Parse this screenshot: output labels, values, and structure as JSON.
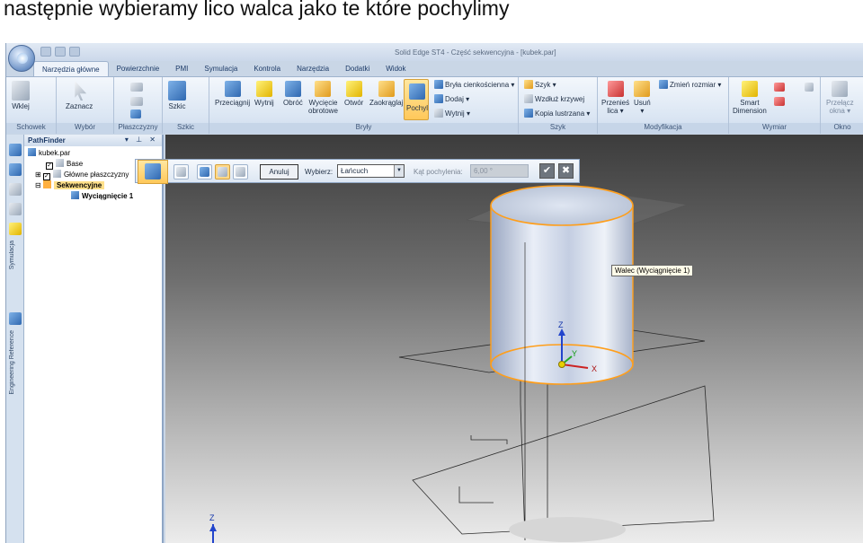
{
  "caption": "następnie wybieramy lico walca jako te które pochylimy",
  "window": {
    "title": "Solid Edge ST4 - Część sekwencyjna - [kubek.par]"
  },
  "tabs": [
    "Narzędzia główne",
    "Powierzchnie",
    "PMI",
    "Symulacja",
    "Kontrola",
    "Narzędzia",
    "Dodatki",
    "Widok"
  ],
  "ribbon": {
    "groups": [
      "Schowek",
      "Wybór",
      "Płaszczyzny",
      "Szkic",
      "Bryły",
      "Szyk",
      "Modyfikacja",
      "Wymiar",
      "Okno"
    ],
    "wklej": "Wklej",
    "zaznacz": "Zaznacz",
    "szkic": "Szkic",
    "przeciagnij": "Przeciągnij",
    "wytnij": "Wytnij",
    "obroc": "Obróć",
    "wyciecie_line1": "Wycięcie",
    "wyciecie_line2": "obrotowe",
    "otwor": "Otwór",
    "zaokraglaj": "Zaokrąglaj",
    "pochyl": "Pochyl",
    "bryla_cienkoscienna": "Bryła cienkościenna",
    "dodaj": "Dodaj",
    "wytnij_small": "Wytnij",
    "szyk": "Szyk",
    "wzdluz_krzywej": "Wzdłuż krzywej",
    "kopia_lustrzana": "Kopia lustrzana",
    "przenies_line1": "Przenieś",
    "przenies_line2": "lica",
    "usun": "Usuń",
    "zmien_rozmiar": "Zmień rozmiar",
    "smart_line1": "Smart",
    "smart_line2": "Dimension",
    "przelacz_line1": "Przełącz",
    "przelacz_line2": "okna"
  },
  "pathfinder": {
    "title": "PathFinder",
    "root": "kubek.par",
    "items": [
      "Base",
      "Główne płaszczyzny",
      "Sekwencyjne",
      "Wyciągnięcie 1"
    ]
  },
  "sidebar_labels": [
    "Symulacja",
    "Engineering Reference"
  ],
  "command_bar": {
    "anuluj": "Anuluj",
    "wybierz_label": "Wybierz:",
    "wybierz_value": "Łańcuch",
    "kat_label": "Kąt pochylenia:",
    "kat_value": "6,00 °"
  },
  "tooltip": "Walec (Wyciągnięcie 1)",
  "axes": {
    "x": "X",
    "y": "Y",
    "z": "Z"
  },
  "colors": {
    "highlight": "#ff9e1a",
    "ribbon": "#dbe6f3",
    "accent": "#ffc85a"
  }
}
